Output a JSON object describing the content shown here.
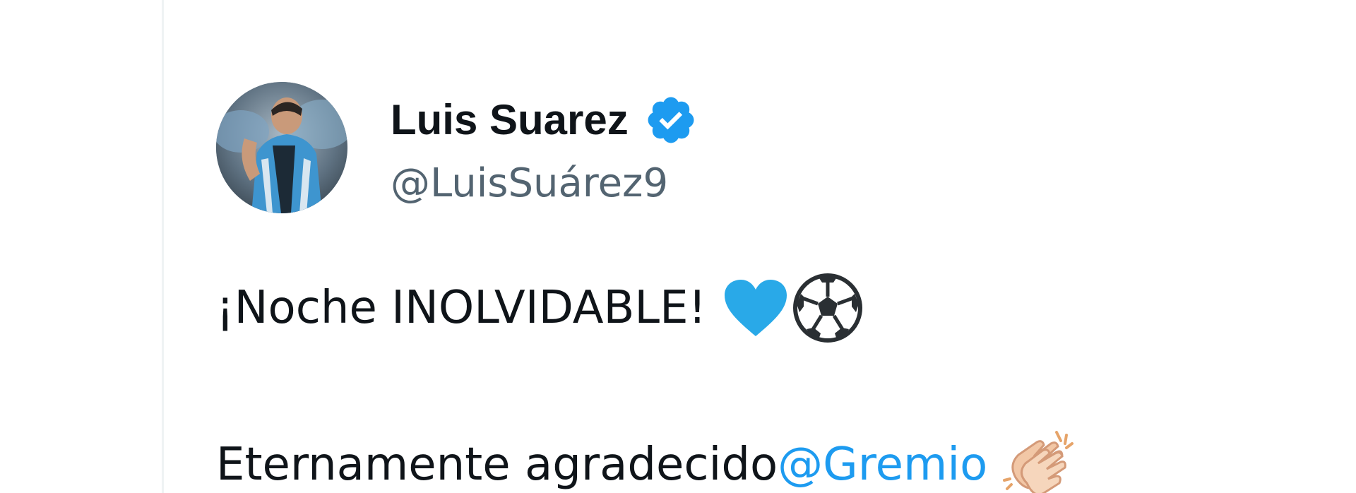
{
  "tweet": {
    "author": {
      "display_name": "Luis Suarez",
      "handle": "@LuisSuárez9",
      "verified": true,
      "avatar_icon": "profile-photo"
    },
    "text": {
      "line1": "¡Noche INOLVIDABLE!",
      "line1_emojis": [
        "blue-heart-icon",
        "soccer-ball-icon"
      ],
      "line2_prefix": "Eternamente agradecido",
      "line2_mention": "@Gremio",
      "line2_emojis": [
        "clapping-hands-icon"
      ]
    }
  },
  "colors": {
    "text_primary": "#0f1419",
    "text_secondary": "#536471",
    "accent": "#1d9bf0",
    "divider": "#eff3f4"
  }
}
